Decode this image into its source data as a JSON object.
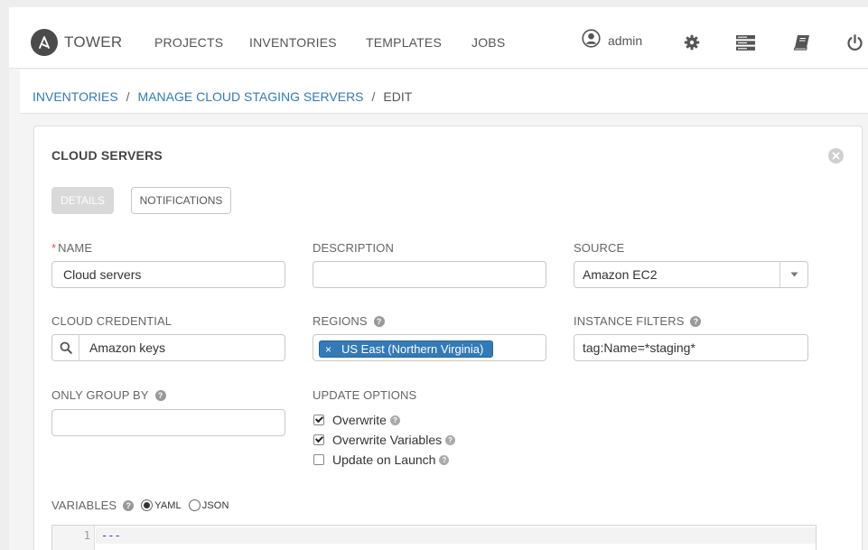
{
  "nav": {
    "brand": "TOWER",
    "links": [
      "PROJECTS",
      "INVENTORIES",
      "TEMPLATES",
      "JOBS"
    ],
    "user": "admin",
    "icons": [
      "user-circle-icon",
      "gear-icon",
      "server-icon",
      "book-icon",
      "power-icon"
    ]
  },
  "breadcrumb": {
    "items": [
      "INVENTORIES",
      "MANAGE CLOUD STAGING SERVERS"
    ],
    "current": "EDIT",
    "separator": "/"
  },
  "panel": {
    "title": "CLOUD SERVERS",
    "tabs": {
      "details": "DETAILS",
      "notifications": "NOTIFICATIONS"
    }
  },
  "form": {
    "name": {
      "label": "NAME",
      "required_mark": "*",
      "value": "Cloud servers"
    },
    "description": {
      "label": "DESCRIPTION",
      "value": ""
    },
    "source": {
      "label": "SOURCE",
      "value": "Amazon EC2"
    },
    "cloud_credential": {
      "label": "CLOUD CREDENTIAL",
      "value": "Amazon keys"
    },
    "regions": {
      "label": "REGIONS",
      "tag_remove": "×",
      "tags": [
        "US East (Northern Virginia)"
      ]
    },
    "instance_filters": {
      "label": "INSTANCE FILTERS",
      "value": "tag:Name=*staging*"
    },
    "only_group_by": {
      "label": "ONLY GROUP BY",
      "value": ""
    },
    "update_options": {
      "label": "UPDATE OPTIONS",
      "options": [
        {
          "label": "Overwrite",
          "checked": true
        },
        {
          "label": "Overwrite Variables",
          "checked": true
        },
        {
          "label": "Update on Launch",
          "checked": false
        }
      ]
    },
    "variables": {
      "label": "VARIABLES",
      "formats": [
        "YAML",
        "JSON"
      ],
      "selected": "YAML",
      "line_number": "1",
      "line_text": "---"
    }
  },
  "colors": {
    "link": "#337ab7",
    "tag": "#337ab7",
    "required": "#d9534f"
  }
}
